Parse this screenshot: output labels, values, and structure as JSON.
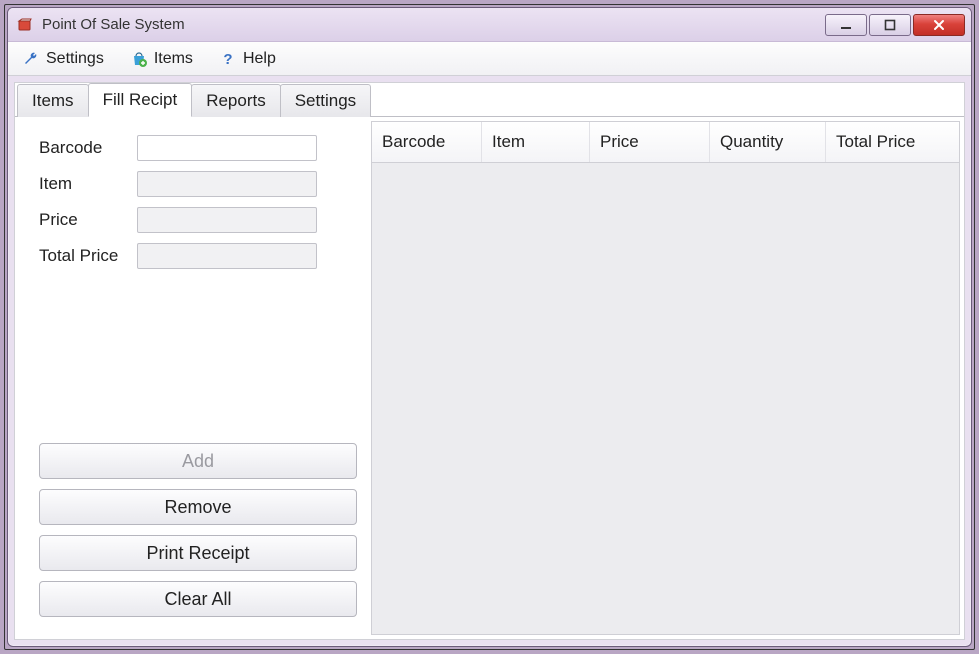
{
  "window": {
    "title": "Point Of Sale System"
  },
  "menubar": {
    "settings": "Settings",
    "items": "Items",
    "help": "Help"
  },
  "tabs": {
    "items": "Items",
    "fill_recipt": "Fill Recipt",
    "reports": "Reports",
    "settings": "Settings",
    "active": "fill_recipt"
  },
  "form": {
    "labels": {
      "barcode": "Barcode",
      "item": "Item",
      "price": "Price",
      "total_price": "Total Price"
    },
    "values": {
      "barcode": "",
      "item": "",
      "price": "",
      "total_price": ""
    }
  },
  "buttons": {
    "add": "Add",
    "remove": "Remove",
    "print_receipt": "Print Receipt",
    "clear_all": "Clear All"
  },
  "grid": {
    "headers": {
      "barcode": "Barcode",
      "item": "Item",
      "price": "Price",
      "quantity": "Quantity",
      "total_price": "Total Price"
    },
    "rows": []
  }
}
